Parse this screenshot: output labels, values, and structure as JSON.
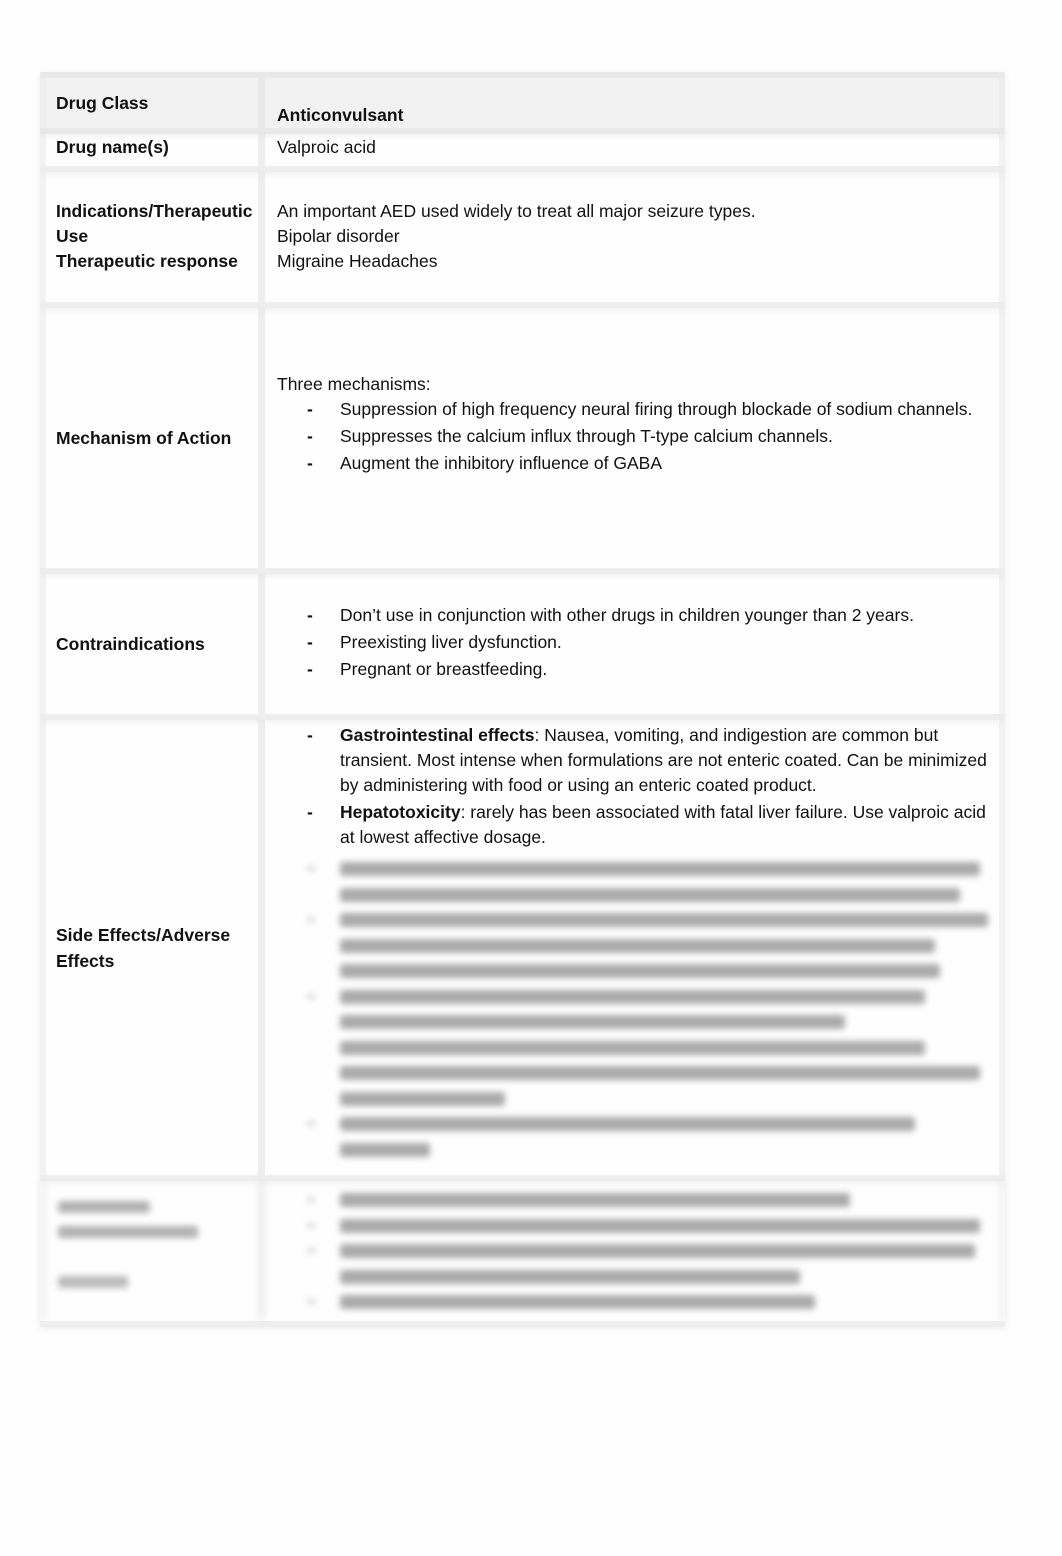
{
  "rows": {
    "drug_class": {
      "label": "Drug Class",
      "value": "Anticonvulsant"
    },
    "drug_name": {
      "label": "Drug name(s)",
      "value": "Valproic acid"
    },
    "indications": {
      "label_line1": "Indications/Therapeutic",
      "label_line2": "Use",
      "label_line3": "Therapeutic response",
      "values": [
        "An important AED used widely to treat all major seizure types.",
        "Bipolar disorder",
        "Migraine Headaches"
      ]
    },
    "mechanism": {
      "label": "Mechanism of Action",
      "intro": "Three mechanisms:",
      "bullet_char": "-",
      "items": [
        "Suppression of high frequency neural firing through blockade of sodium channels.",
        "Suppresses the calcium influx through T-type calcium channels.",
        "Augment the inhibitory influence of GABA"
      ]
    },
    "contraindications": {
      "label": "Contraindications",
      "items": [
        "Don’t use in conjunction with other drugs in children younger than 2 years.",
        "Preexisting liver dysfunction.",
        "Pregnant or breastfeeding."
      ]
    },
    "side_effects": {
      "label_line1": "Side Effects/Adverse",
      "label_line2": "Effects",
      "items": [
        {
          "term": "Gastrointestinal effects",
          "text": ": Nausea, vomiting, and indigestion are common but transient. Most intense when formulations are not enteric coated. Can be minimized by administering with food or using an enteric coated product."
        },
        {
          "term": "Hepatotoxicity",
          "text": ": rarely has been associated with fatal liver failure. Use valproic acid at lowest affective dosage."
        }
      ],
      "obscured_note": "remaining content blurred / not legible"
    },
    "monitoring": {
      "obscured_note": "row content blurred / not legible"
    }
  }
}
